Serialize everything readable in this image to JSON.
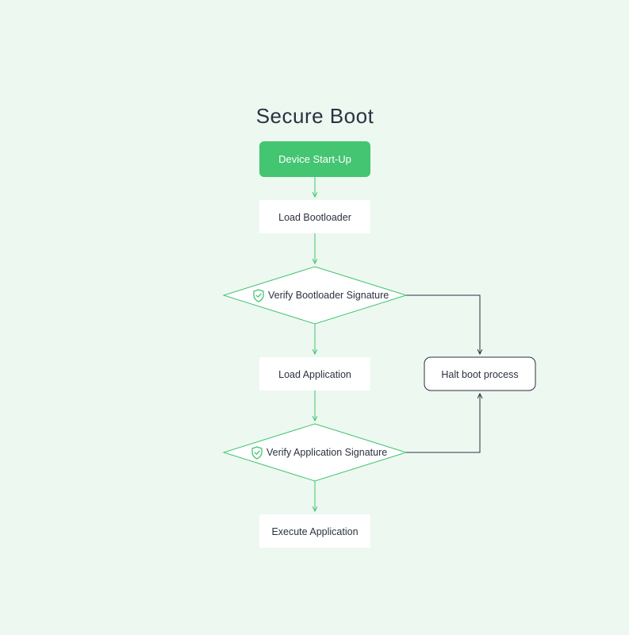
{
  "title": "Secure Boot",
  "nodes": {
    "start": "Device Start-Up",
    "load_bootloader": "Load Bootloader",
    "verify_bootloader": "Verify Bootloader Signature",
    "load_application": "Load Application",
    "halt": "Halt boot process",
    "verify_application": "Verify Application Signature",
    "execute": "Execute Application"
  },
  "icon": "shield-icon",
  "colors": {
    "background": "#edf8f0",
    "accent": "#44c571",
    "box": "#ffffff",
    "text": "#2b3140"
  }
}
